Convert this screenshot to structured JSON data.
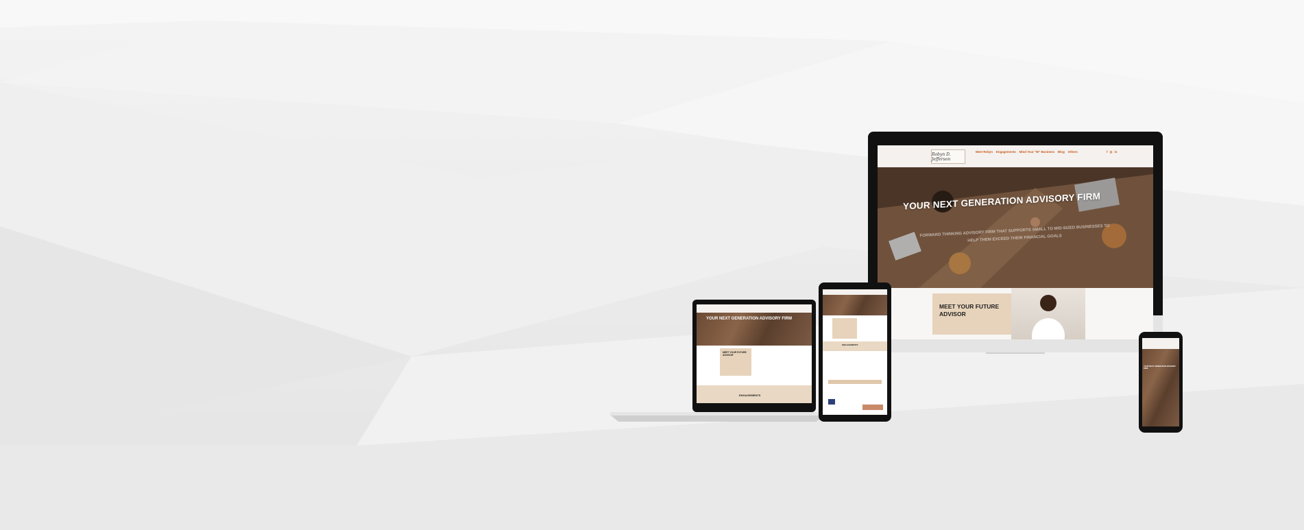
{
  "desktop": {
    "logo_text": "Robyn D. Jefferson",
    "menu": [
      "Meet Robyn",
      "Engagements",
      "Mind Your \"W\" Business",
      "Blog",
      "Others"
    ],
    "social_icons": [
      "facebook-icon",
      "instagram-icon",
      "linkedin-icon"
    ],
    "social_glyphs": [
      "f",
      "◎",
      "in"
    ],
    "hero_title": "YOUR NEXT GENERATION ADVISORY FIRM",
    "hero_subtitle": "FORWARD THINKING ADVISORY FIRM THAT SUPPORTS SMALL TO MID-SIZED BUSINESSES TO HELP THEM EXCEED THEIR FINANCIAL GOALS",
    "advisor_heading": "MEET YOUR FUTURE ADVISOR"
  },
  "laptop": {
    "hero_title": "YOUR NEXT GENERATION ADVISORY FIRM",
    "advisor_heading": "MEET YOUR FUTURE ADVISOR",
    "section_title": "ENGAGEMENTS"
  },
  "tablet": {
    "section_title": "ENGAGEMENTS"
  },
  "phone": {
    "hero_title": "YOUR NEXT GENERATION ADVISORY FIRM"
  },
  "colors": {
    "accent": "#c85a1e",
    "beige": "#e7d3bb",
    "hero_brown": "#6b4a34",
    "device_black": "#111111",
    "device_silver": "#d6d6d6"
  }
}
